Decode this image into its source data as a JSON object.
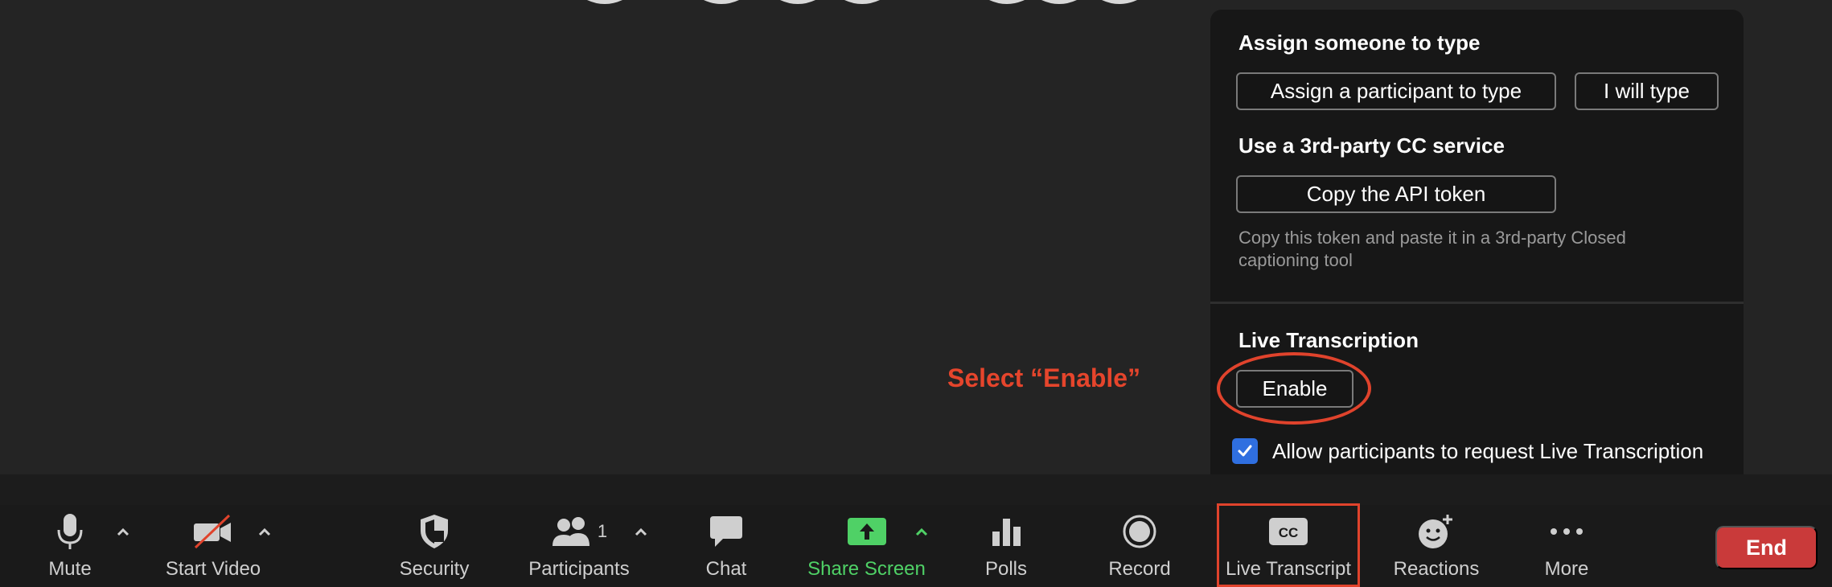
{
  "popup": {
    "assign_title": "Assign someone to type",
    "assign_participant_label": "Assign a participant to type",
    "i_will_type_label": "I will type",
    "third_party_title": "Use a 3rd-party CC service",
    "copy_token_label": "Copy the API token",
    "copy_token_helper": "Copy this token and paste it in a 3rd-party Closed captioning tool",
    "live_title": "Live Transcription",
    "enable_label": "Enable",
    "allow_checkbox_label": "Allow participants to request Live Transcription",
    "allow_checked": true
  },
  "annotation": {
    "text": "Select “Enable”",
    "color": "#e5452c"
  },
  "toolbar": {
    "items": [
      {
        "label": "Mute",
        "icon": "microphone-icon"
      },
      {
        "label": "Start Video",
        "icon": "video-off-icon"
      },
      {
        "label": "Security",
        "icon": "shield-icon"
      },
      {
        "label": "Participants",
        "icon": "participants-icon",
        "count": "1"
      },
      {
        "label": "Chat",
        "icon": "chat-bubble-icon"
      },
      {
        "label": "Share Screen",
        "icon": "share-screen-icon",
        "color": "#4fd166"
      },
      {
        "label": "Polls",
        "icon": "bar-chart-icon"
      },
      {
        "label": "Record",
        "icon": "record-icon"
      },
      {
        "label": "Live Transcript",
        "icon": "cc-icon"
      },
      {
        "label": "Reactions",
        "icon": "smiley-add-icon"
      },
      {
        "label": "More",
        "icon": "ellipsis-icon"
      }
    ],
    "end_label": "End",
    "end_color": "#c93a3a"
  }
}
